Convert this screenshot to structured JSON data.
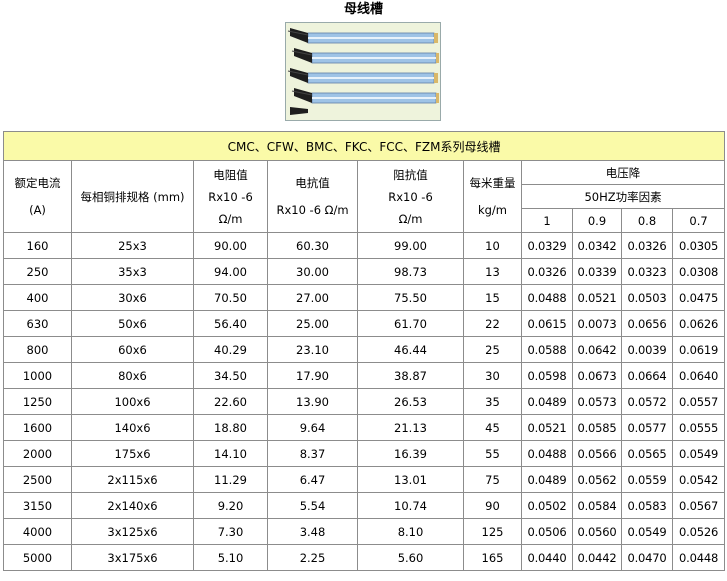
{
  "title": "母线槽",
  "table": {
    "banner": "CMC、CFW、BMC、FKC、FCC、FZM系列母线槽",
    "headers": {
      "current": [
        "额定电流",
        "(A)"
      ],
      "busbar": "每相铜排规格 (mm)",
      "resistance": [
        "电阻值",
        "Rx10 -6",
        "Ω/m"
      ],
      "reactance": [
        "电抗值",
        "Rx10 -6 Ω/m"
      ],
      "impedance": [
        "阻抗值",
        "Rx10 -6",
        "Ω/m"
      ],
      "weight": [
        "每米重量",
        "kg/m"
      ],
      "voltage_drop": "电压降",
      "power_factor": "50HZ功率因素",
      "pf_values": [
        "1",
        "0.9",
        "0.8",
        "0.7"
      ]
    },
    "rows": [
      {
        "current": "160",
        "busbar": "25x3",
        "r": "90.00",
        "x": "60.30",
        "z": "99.00",
        "w": "10",
        "vd": [
          "0.0329",
          "0.0342",
          "0.0326",
          "0.0305"
        ]
      },
      {
        "current": "250",
        "busbar": "35x3",
        "r": "94.00",
        "x": "30.00",
        "z": "98.73",
        "w": "13",
        "vd": [
          "0.0326",
          "0.0339",
          "0.0323",
          "0.0308"
        ]
      },
      {
        "current": "400",
        "busbar": "30x6",
        "r": "70.50",
        "x": "27.00",
        "z": "75.50",
        "w": "15",
        "vd": [
          "0.0488",
          "0.0521",
          "0.0503",
          "0.0475"
        ]
      },
      {
        "current": "630",
        "busbar": "50x6",
        "r": "56.40",
        "x": "25.00",
        "z": "61.70",
        "w": "22",
        "vd": [
          "0.0615",
          "0.0073",
          "0.0656",
          "0.0626"
        ]
      },
      {
        "current": "800",
        "busbar": "60x6",
        "r": "40.29",
        "x": "23.10",
        "z": "46.44",
        "w": "25",
        "vd": [
          "0.0588",
          "0.0642",
          "0.0039",
          "0.0619"
        ]
      },
      {
        "current": "1000",
        "busbar": "80x6",
        "r": "34.50",
        "x": "17.90",
        "z": "38.87",
        "w": "30",
        "vd": [
          "0.0598",
          "0.0673",
          "0.0664",
          "0.0640"
        ]
      },
      {
        "current": "1250",
        "busbar": "100x6",
        "r": "22.60",
        "x": "13.90",
        "z": "26.53",
        "w": "35",
        "vd": [
          "0.0489",
          "0.0573",
          "0.0572",
          "0.0557"
        ]
      },
      {
        "current": "1600",
        "busbar": "140x6",
        "r": "18.80",
        "x": "9.64",
        "z": "21.13",
        "w": "45",
        "vd": [
          "0.0521",
          "0.0585",
          "0.0577",
          "0.0555"
        ]
      },
      {
        "current": "2000",
        "busbar": "175x6",
        "r": "14.10",
        "x": "8.37",
        "z": "16.39",
        "w": "55",
        "vd": [
          "0.0488",
          "0.0566",
          "0.0565",
          "0.0549"
        ]
      },
      {
        "current": "2500",
        "busbar": "2x115x6",
        "r": "11.29",
        "x": "6.47",
        "z": "13.01",
        "w": "75",
        "vd": [
          "0.0489",
          "0.0562",
          "0.0559",
          "0.0542"
        ]
      },
      {
        "current": "3150",
        "busbar": "2x140x6",
        "r": "9.20",
        "x": "5.54",
        "z": "10.74",
        "w": "90",
        "vd": [
          "0.0502",
          "0.0584",
          "0.0583",
          "0.0567"
        ]
      },
      {
        "current": "4000",
        "busbar": "3x125x6",
        "r": "7.30",
        "x": "3.48",
        "z": "8.10",
        "w": "125",
        "vd": [
          "0.0506",
          "0.0560",
          "0.0549",
          "0.0526"
        ]
      },
      {
        "current": "5000",
        "busbar": "3x175x6",
        "r": "5.10",
        "x": "2.25",
        "z": "5.60",
        "w": "165",
        "vd": [
          "0.0440",
          "0.0442",
          "0.0470",
          "0.0448"
        ]
      }
    ]
  }
}
